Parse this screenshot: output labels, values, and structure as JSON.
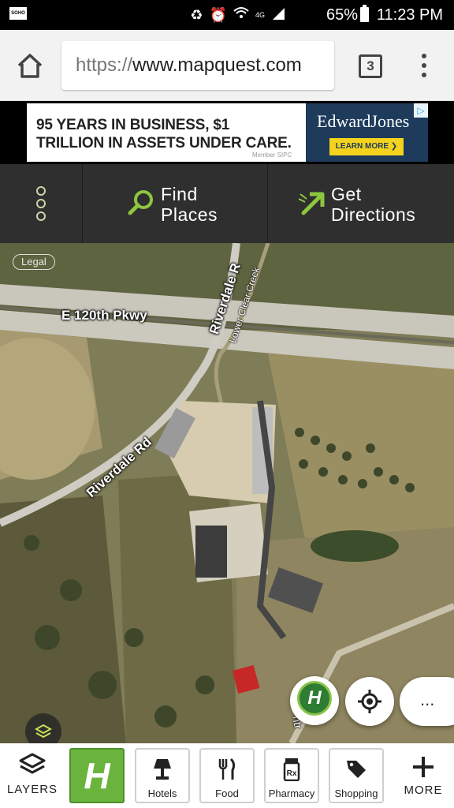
{
  "status_bar": {
    "battery": "65%",
    "time": "11:23 PM",
    "network": "4G"
  },
  "browser": {
    "url_scheme": "https://",
    "url_host": "www.mapquest.com",
    "tab_count": "3"
  },
  "ad": {
    "headline_line1": "95 YEARS IN BUSINESS, $1",
    "headline_line2": "TRILLION IN ASSETS UNDER CARE.",
    "member": "Member SIPC",
    "brand": "EdwardJones",
    "cta": "LEARN MORE ❯",
    "adchoices_icon": "adchoices-icon"
  },
  "mq_nav": {
    "find_line1": "Find",
    "find_line2": "Places",
    "dir_line1": "Get",
    "dir_line2": "Directions",
    "accent_color": "#8dc63f"
  },
  "map": {
    "legal": "Legal",
    "labels": {
      "parkway": "E 120th Pkwy",
      "riverdale_top": "Riverdale R",
      "riverdale_left": "Riverdale Rd",
      "creek": "Lower Clear Creek",
      "bottom_road": "ntr"
    },
    "more_label": "..."
  },
  "categories": {
    "layers": "LAYERS",
    "hotels": "Hotels",
    "food": "Food",
    "pharmacy": "Pharmacy",
    "shopping": "Shopping",
    "more": "MORE"
  }
}
